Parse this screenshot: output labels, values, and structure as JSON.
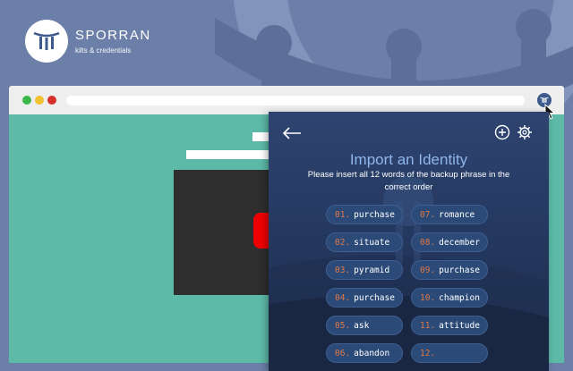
{
  "brand": {
    "name": "SPORRAN",
    "tagline": "kilts & credentials"
  },
  "colors": {
    "accent": "#8fb6ec",
    "number": "#e07846",
    "pill": "#2b4a78",
    "page": "#5dbaa8"
  },
  "popup": {
    "title": "Import an Identity",
    "subtitle": "Please insert all 12 words of the backup phrase in the correct order",
    "icons": {
      "back": "arrow-left-icon",
      "add": "plus-circle-icon",
      "settings": "gear-icon"
    },
    "words": [
      {
        "num": "01.",
        "word": "purchase"
      },
      {
        "num": "07.",
        "word": "romance"
      },
      {
        "num": "02.",
        "word": "situate"
      },
      {
        "num": "08.",
        "word": "december"
      },
      {
        "num": "03.",
        "word": "pyramid"
      },
      {
        "num": "09.",
        "word": "purchase"
      },
      {
        "num": "04.",
        "word": "purchase"
      },
      {
        "num": "10.",
        "word": "champion"
      },
      {
        "num": "05.",
        "word": "ask"
      },
      {
        "num": "11.",
        "word": "attitude"
      },
      {
        "num": "06.",
        "word": "abandon"
      },
      {
        "num": "12.",
        "word": ""
      }
    ]
  }
}
